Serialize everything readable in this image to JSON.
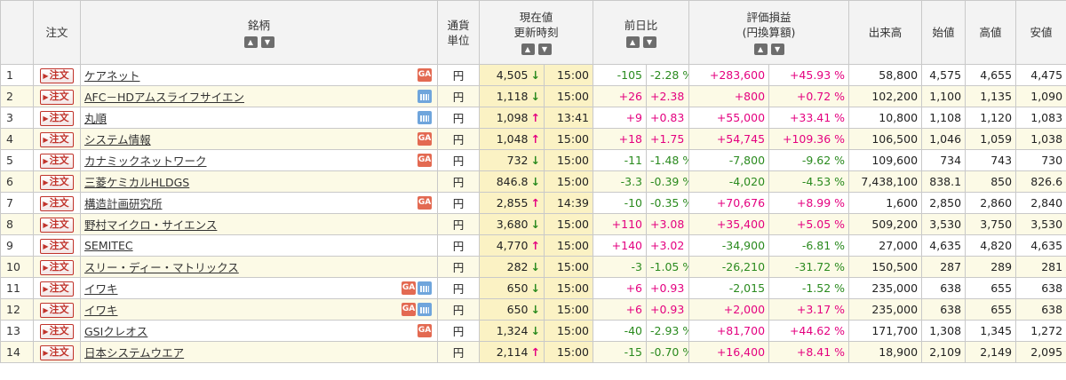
{
  "headers": {
    "no": "",
    "order": "注文",
    "name": "銘柄",
    "currency_line1": "通貨",
    "currency_line2": "単位",
    "price_line1": "現在値",
    "price_line2": "更新時刻",
    "change": "前日比",
    "pl_line1": "評価損益",
    "pl_line2": "(円換算額)",
    "volume": "出来高",
    "open": "始値",
    "high": "高値",
    "low": "安値",
    "sort_up": "▲",
    "sort_down": "▼"
  },
  "order_label": "注文",
  "rows": [
    {
      "no": "1",
      "name": "ケアネット",
      "icons": [
        "ga-icon"
      ],
      "currency": "円",
      "price": "4,505",
      "dir": "down",
      "time": "15:00",
      "change": "-105",
      "change_pct": "-2.28 %",
      "pl": "+283,600",
      "pl_pct": "+45.93 %",
      "volume": "58,800",
      "open": "4,575",
      "high": "4,655",
      "low": "4,475"
    },
    {
      "no": "2",
      "name": "AFC－HDアムスライフサイエン",
      "icons": [
        "calendar-icon"
      ],
      "currency": "円",
      "price": "1,118",
      "dir": "down",
      "time": "15:00",
      "change": "+26",
      "change_pct": "+2.38 %",
      "pl": "+800",
      "pl_pct": "+0.72 %",
      "volume": "102,200",
      "open": "1,100",
      "high": "1,135",
      "low": "1,090"
    },
    {
      "no": "3",
      "name": "丸順",
      "icons": [
        "calendar-icon"
      ],
      "currency": "円",
      "price": "1,098",
      "dir": "up",
      "time": "13:41",
      "change": "+9",
      "change_pct": "+0.83 %",
      "pl": "+55,000",
      "pl_pct": "+33.41 %",
      "volume": "10,800",
      "open": "1,108",
      "high": "1,120",
      "low": "1,083"
    },
    {
      "no": "4",
      "name": "システム情報",
      "icons": [
        "ga-icon"
      ],
      "currency": "円",
      "price": "1,048",
      "dir": "up",
      "time": "15:00",
      "change": "+18",
      "change_pct": "+1.75 %",
      "pl": "+54,745",
      "pl_pct": "+109.36 %",
      "volume": "106,500",
      "open": "1,046",
      "high": "1,059",
      "low": "1,038"
    },
    {
      "no": "5",
      "name": "カナミックネットワーク",
      "icons": [
        "ga-icon"
      ],
      "currency": "円",
      "price": "732",
      "dir": "down",
      "time": "15:00",
      "change": "-11",
      "change_pct": "-1.48 %",
      "pl": "-7,800",
      "pl_pct": "-9.62 %",
      "volume": "109,600",
      "open": "734",
      "high": "743",
      "low": "730"
    },
    {
      "no": "6",
      "name": "三菱ケミカルHLDGS",
      "icons": [],
      "currency": "円",
      "price": "846.8",
      "dir": "down",
      "time": "15:00",
      "change": "-3.3",
      "change_pct": "-0.39 %",
      "pl": "-4,020",
      "pl_pct": "-4.53 %",
      "volume": "7,438,100",
      "open": "838.1",
      "high": "850",
      "low": "826.6"
    },
    {
      "no": "7",
      "name": "構造計画研究所",
      "icons": [
        "ga-icon"
      ],
      "currency": "円",
      "price": "2,855",
      "dir": "up",
      "time": "14:39",
      "change": "-10",
      "change_pct": "-0.35 %",
      "pl": "+70,676",
      "pl_pct": "+8.99 %",
      "volume": "1,600",
      "open": "2,850",
      "high": "2,860",
      "low": "2,840"
    },
    {
      "no": "8",
      "name": "野村マイクロ・サイエンス",
      "icons": [],
      "currency": "円",
      "price": "3,680",
      "dir": "down",
      "time": "15:00",
      "change": "+110",
      "change_pct": "+3.08 %",
      "pl": "+35,400",
      "pl_pct": "+5.05 %",
      "volume": "509,200",
      "open": "3,530",
      "high": "3,750",
      "low": "3,530"
    },
    {
      "no": "9",
      "name": "SEMITEC",
      "icons": [],
      "currency": "円",
      "price": "4,770",
      "dir": "up",
      "time": "15:00",
      "change": "+140",
      "change_pct": "+3.02 %",
      "pl": "-34,900",
      "pl_pct": "-6.81 %",
      "volume": "27,000",
      "open": "4,635",
      "high": "4,820",
      "low": "4,635"
    },
    {
      "no": "10",
      "name": "スリー・ディー・マトリックス",
      "icons": [],
      "currency": "円",
      "price": "282",
      "dir": "down",
      "time": "15:00",
      "change": "-3",
      "change_pct": "-1.05 %",
      "pl": "-26,210",
      "pl_pct": "-31.72 %",
      "volume": "150,500",
      "open": "287",
      "high": "289",
      "low": "281"
    },
    {
      "no": "11",
      "name": "イワキ",
      "icons": [
        "ga-icon",
        "calendar-icon"
      ],
      "currency": "円",
      "price": "650",
      "dir": "down",
      "time": "15:00",
      "change": "+6",
      "change_pct": "+0.93 %",
      "pl": "-2,015",
      "pl_pct": "-1.52 %",
      "volume": "235,000",
      "open": "638",
      "high": "655",
      "low": "638"
    },
    {
      "no": "12",
      "name": "イワキ",
      "icons": [
        "ga-icon",
        "calendar-icon"
      ],
      "currency": "円",
      "price": "650",
      "dir": "down",
      "time": "15:00",
      "change": "+6",
      "change_pct": "+0.93 %",
      "pl": "+2,000",
      "pl_pct": "+3.17 %",
      "volume": "235,000",
      "open": "638",
      "high": "655",
      "low": "638"
    },
    {
      "no": "13",
      "name": "GSIクレオス",
      "icons": [
        "ga-icon"
      ],
      "currency": "円",
      "price": "1,324",
      "dir": "down",
      "time": "15:00",
      "change": "-40",
      "change_pct": "-2.93 %",
      "pl": "+81,700",
      "pl_pct": "+44.62 %",
      "volume": "171,700",
      "open": "1,308",
      "high": "1,345",
      "low": "1,272"
    },
    {
      "no": "14",
      "name": "日本システムウエア",
      "icons": [],
      "currency": "円",
      "price": "2,114",
      "dir": "up",
      "time": "15:00",
      "change": "-15",
      "change_pct": "-0.70 %",
      "pl": "+16,400",
      "pl_pct": "+8.41 %",
      "volume": "18,900",
      "open": "2,109",
      "high": "2,149",
      "low": "2,095"
    }
  ],
  "arrows": {
    "up": "↑",
    "down": "↓"
  },
  "colors": {
    "positive": "#e4007f",
    "negative": "#2a8a1e",
    "price_bg": "#fbf2c4",
    "even_row_bg": "#fcfae6",
    "header_bg": "#f3f3f3"
  }
}
